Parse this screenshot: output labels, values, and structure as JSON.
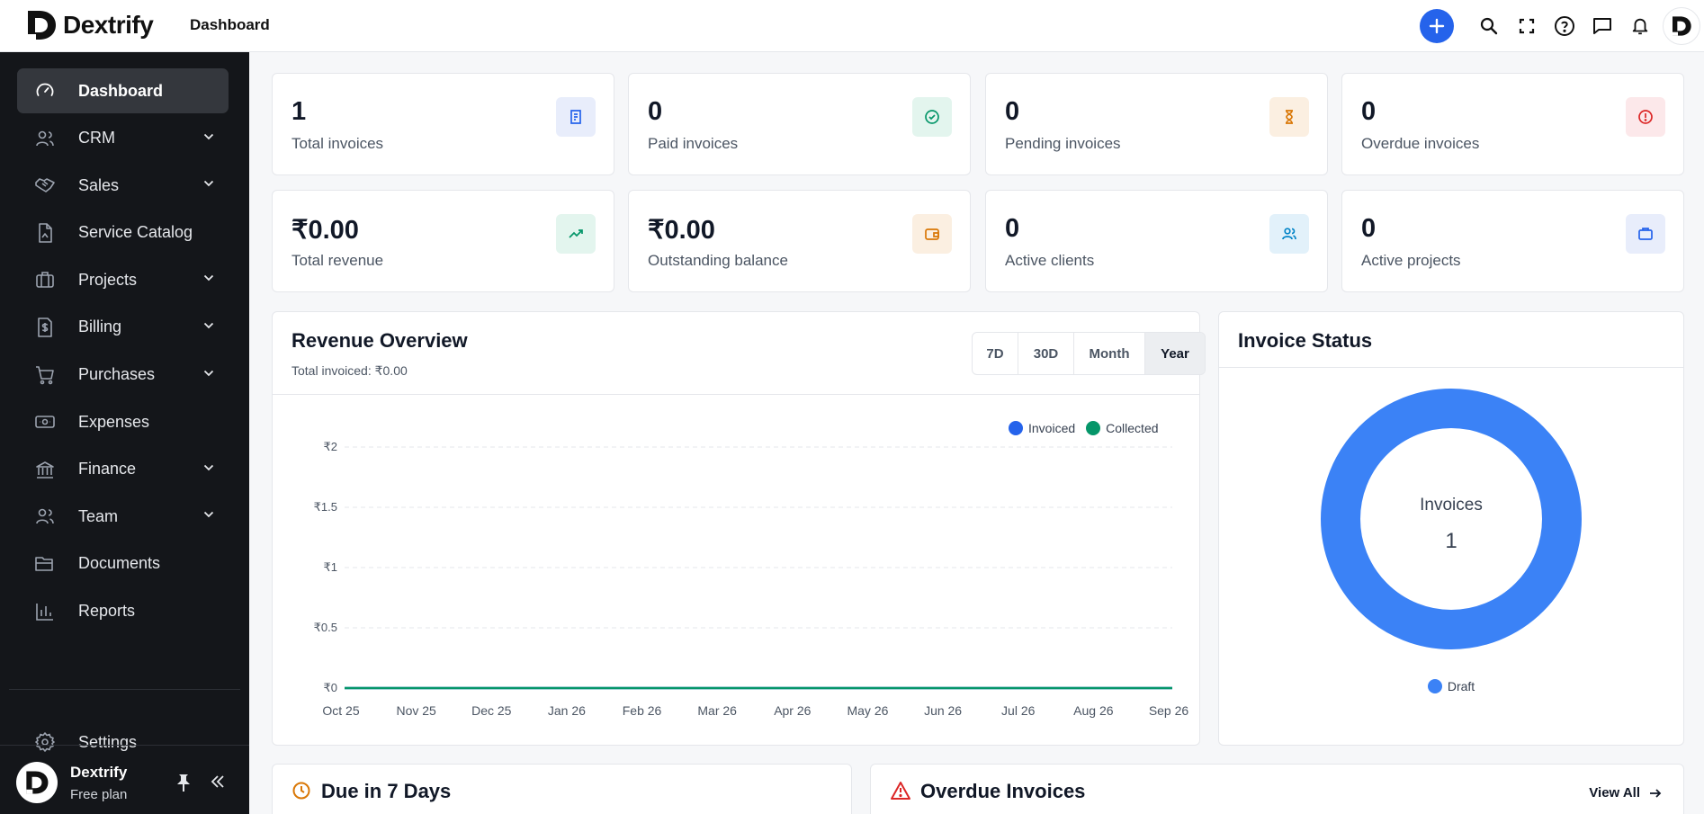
{
  "app": {
    "brand": "Dextrify",
    "page_title": "Dashboard"
  },
  "topbar": {
    "icons": [
      "plus-icon",
      "search-icon",
      "fullscreen-icon",
      "help-icon",
      "chat-icon",
      "bell-icon"
    ],
    "avatar_letter": "D"
  },
  "sidebar": {
    "items": [
      {
        "label": "Dashboard",
        "icon": "gauge-icon",
        "active": true,
        "expandable": false
      },
      {
        "label": "CRM",
        "icon": "users-icon",
        "expandable": true
      },
      {
        "label": "Sales",
        "icon": "handshake-icon",
        "expandable": true
      },
      {
        "label": "Service Catalog",
        "icon": "file-icon",
        "expandable": false
      },
      {
        "label": "Projects",
        "icon": "briefcase-icon",
        "expandable": true
      },
      {
        "label": "Billing",
        "icon": "dollar-file-icon",
        "expandable": true
      },
      {
        "label": "Purchases",
        "icon": "cart-icon",
        "expandable": true
      },
      {
        "label": "Expenses",
        "icon": "banknote-icon",
        "expandable": false
      },
      {
        "label": "Finance",
        "icon": "bank-icon",
        "expandable": true
      },
      {
        "label": "Team",
        "icon": "team-icon",
        "expandable": true
      },
      {
        "label": "Documents",
        "icon": "folder-icon",
        "expandable": false
      },
      {
        "label": "Reports",
        "icon": "bar-chart-icon",
        "expandable": false
      }
    ],
    "settings_label": "Settings",
    "user": {
      "name": "Dextrify",
      "plan": "Free plan"
    }
  },
  "stats": [
    {
      "value": "1",
      "label": "Total invoices",
      "icon": "invoice-icon",
      "color": "#2563eb",
      "bg": "#e8edfb"
    },
    {
      "value": "0",
      "label": "Paid invoices",
      "icon": "check-circle-icon",
      "color": "#059669",
      "bg": "#e3f5ee"
    },
    {
      "value": "0",
      "label": "Pending invoices",
      "icon": "hourglass-icon",
      "color": "#d97706",
      "bg": "#fbefe1"
    },
    {
      "value": "0",
      "label": "Overdue invoices",
      "icon": "alert-circle-icon",
      "color": "#dc2626",
      "bg": "#fce8ea"
    },
    {
      "value": "₹0.00",
      "label": "Total revenue",
      "icon": "trending-up-icon",
      "color": "#059669",
      "bg": "#e3f5ee"
    },
    {
      "value": "₹0.00",
      "label": "Outstanding balance",
      "icon": "wallet-icon",
      "color": "#d97706",
      "bg": "#fbefe1"
    },
    {
      "value": "0",
      "label": "Active clients",
      "icon": "clients-icon",
      "color": "#0284c7",
      "bg": "#e2f1fa"
    },
    {
      "value": "0",
      "label": "Active projects",
      "icon": "briefcase-icon",
      "color": "#2563eb",
      "bg": "#e8edfb"
    }
  ],
  "revenue": {
    "title": "Revenue Overview",
    "subtitle": "Total invoiced: ₹0.00",
    "ranges": [
      "7D",
      "30D",
      "Month",
      "Year"
    ],
    "selected_range": "Year"
  },
  "invoice_status": {
    "title": "Invoice Status",
    "center_label": "Invoices",
    "center_value": "1"
  },
  "due": {
    "title": "Due in 7 Days"
  },
  "overdue": {
    "title": "Overdue Invoices",
    "view_all": "View All"
  },
  "chart_data": [
    {
      "type": "line",
      "title": "Revenue Overview",
      "x": [
        "Oct 25",
        "Nov 25",
        "Dec 25",
        "Jan 26",
        "Feb 26",
        "Mar 26",
        "Apr 26",
        "May 26",
        "Jun 26",
        "Jul 26",
        "Aug 26",
        "Sep 26"
      ],
      "y_ticks": [
        "₹0",
        "₹0.5",
        "₹1",
        "₹1.5",
        "₹2"
      ],
      "ylim": [
        0,
        2
      ],
      "series": [
        {
          "name": "Invoiced",
          "color": "#2563eb",
          "values": [
            0,
            0,
            0,
            0,
            0,
            0,
            0,
            0,
            0,
            0,
            0,
            0
          ]
        },
        {
          "name": "Collected",
          "color": "#059669",
          "values": [
            0,
            0,
            0,
            0,
            0,
            0,
            0,
            0,
            0,
            0,
            0,
            0
          ]
        }
      ],
      "grid": true,
      "legend": "top-right"
    },
    {
      "type": "pie",
      "title": "Invoice Status",
      "categories": [
        "Draft"
      ],
      "values": [
        1
      ],
      "colors": [
        "#3b82f6"
      ],
      "legend": "bottom"
    }
  ]
}
